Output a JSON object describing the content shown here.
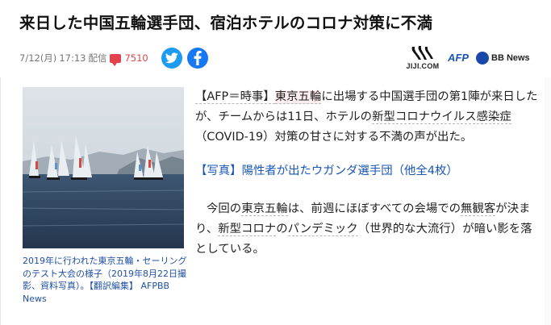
{
  "article": {
    "title": "来日した中国五輪選手団、宿泊ホテルのコロナ対策に不満",
    "date": "7/12(月)",
    "time": "17:13",
    "delivery_label": "配信",
    "comment_count": "7510"
  },
  "providers": {
    "jiji": "JIJI.COM",
    "afp": "AFP",
    "bb": "BB News"
  },
  "photo": {
    "caption": "2019年に行われた東京五輪・セーリングのテスト大会の様子（2019年8月22日撮影、資料写真）。【翻訳編集】 AFPBB News"
  },
  "body": {
    "p1_a": "【AFP＝時事】",
    "p1_b": "東京五輪",
    "p1_c": "に出場する中国選手団の第1陣が来日したが、チームからは11日、ホテルの",
    "p1_d": "新型コロナウイルス感染症",
    "p1_e": "（COVID-19）対策の甘さに対する不満の声が出た。",
    "link": "【写真】陽性者が出たウガンダ選手団（他全4枚）",
    "p2_a": "今回の",
    "p2_b": "東京五輪",
    "p2_c": "は、前週にほぼすべての会場での",
    "p2_d": "無観客",
    "p2_e": "が決まり、",
    "p2_f": "新型コロナ",
    "p2_g": "の",
    "p2_h": "パンデミック",
    "p2_i": "（世界的な大流行）が暗い影を落としている。"
  },
  "colors": {
    "link_blue": "#1a56b5",
    "comment_red": "#e2424b",
    "twitter": "#1d9bf0",
    "facebook": "#1877f2"
  }
}
